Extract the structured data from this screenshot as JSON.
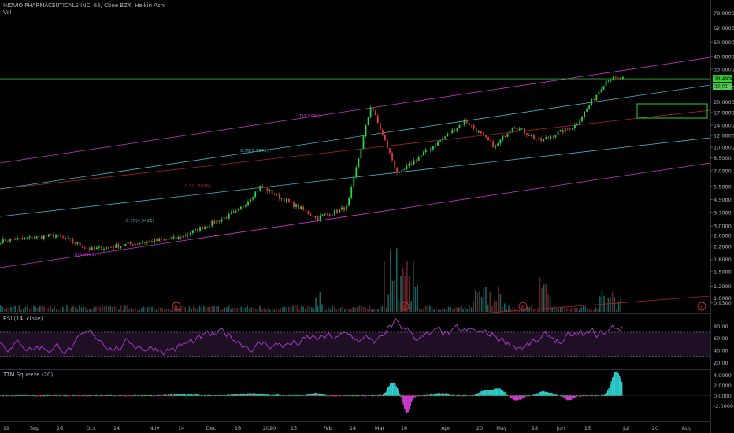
{
  "header": {
    "title": "INOVIO PHARMACEUTICALS INC, 65, Cboe BZX, Heikin Ashi",
    "volume_label": "Vol"
  },
  "rsi_panel": {
    "label": "RSI (14, close)"
  },
  "ttm_panel": {
    "label": "TTM Squeeze (20)"
  },
  "colors": {
    "background": "#000000",
    "bull": "#26d646",
    "bear": "#e23a3a",
    "magenta": "#d633d6",
    "cyan": "#3fb7c9",
    "red_mid": "#a0262d",
    "green_line": "#33a833",
    "rsi_line": "#b43cd2",
    "ttm_pos": "#2fd3d3",
    "ttm_neg": "#d23cd2"
  },
  "chart_data": [
    {
      "type": "candlestick",
      "title": "INOVIO PHARMACEUTICALS INC, 65, Cboe BZX, Heikin Ashi",
      "scale": "log",
      "y_ticks": [
        "96.0000",
        "78.0000",
        "62.0000",
        "50.0000",
        "40.0000",
        "33.0000",
        "25.0000",
        "20.0000",
        "17.0000",
        "14.0000",
        "12.0000",
        "10.0000",
        "8.5000",
        "7.0000",
        "5.5000",
        "4.5000",
        "3.7000",
        "3.0000",
        "2.6000",
        "2.2000",
        "1.8000",
        "1.5000",
        "1.2000",
        "1.0000",
        "0.9300"
      ],
      "x_ticks": [
        "19",
        "Sep",
        "16",
        "Oct",
        "14",
        "Nov",
        "14",
        "Dec",
        "16",
        "2020",
        "15",
        "Feb",
        "14",
        "Mar",
        "16",
        "Apr",
        "20",
        "May",
        "18",
        "Jun",
        "15",
        "Jul",
        "20",
        "Aug"
      ],
      "price_labels": [
        "28.4900",
        "26.01"
      ],
      "horizontal_line": 28.49,
      "pitchfork_labels": [
        "1(1.8936)",
        "0.75(2.7940)",
        "0.5(1.8836)",
        "0.75(4.5421)",
        "0(5.4169)"
      ],
      "earnings_markers": [
        "E",
        "E",
        "E",
        "E"
      ],
      "key_points": [
        {
          "date": "Aug 2019",
          "close": 2.4
        },
        {
          "date": "Sep 16",
          "close": 2.6
        },
        {
          "date": "Oct 2019",
          "close": 2.1
        },
        {
          "date": "Nov 2019",
          "close": 2.3
        },
        {
          "date": "Dec 2019",
          "close": 2.5
        },
        {
          "date": "Jan 2020",
          "close": 3.7
        },
        {
          "date": "Jan 2020",
          "close": 5.5
        },
        {
          "date": "Feb 2020",
          "close": 3.4
        },
        {
          "date": "Feb 2020",
          "close": 4.0
        },
        {
          "date": "Mar 2020",
          "close": 19.0
        },
        {
          "date": "Mar 2020",
          "close": 6.5
        },
        {
          "date": "Apr 2020",
          "close": 8.0
        },
        {
          "date": "Apr 2020",
          "close": 15.0
        },
        {
          "date": "May 2020",
          "close": 10.0
        },
        {
          "date": "May 2020",
          "close": 14.0
        },
        {
          "date": "Jun 2020",
          "close": 11.0
        },
        {
          "date": "Jun 2020",
          "close": 14.0
        },
        {
          "date": "Jun 2020",
          "close": 28.5
        }
      ]
    },
    {
      "type": "line",
      "title": "RSI (14, close)",
      "y_ticks": [
        "80.00",
        "60.00",
        "40.00",
        "20.00"
      ],
      "ylim": [
        10,
        100
      ],
      "bands": [
        70,
        30
      ]
    },
    {
      "type": "area",
      "title": "TTM Squeeze (20)",
      "y_ticks": [
        "4.0000",
        "2.0000",
        "0.0000",
        "-2.0000"
      ],
      "ylim": [
        -5,
        5
      ]
    }
  ]
}
